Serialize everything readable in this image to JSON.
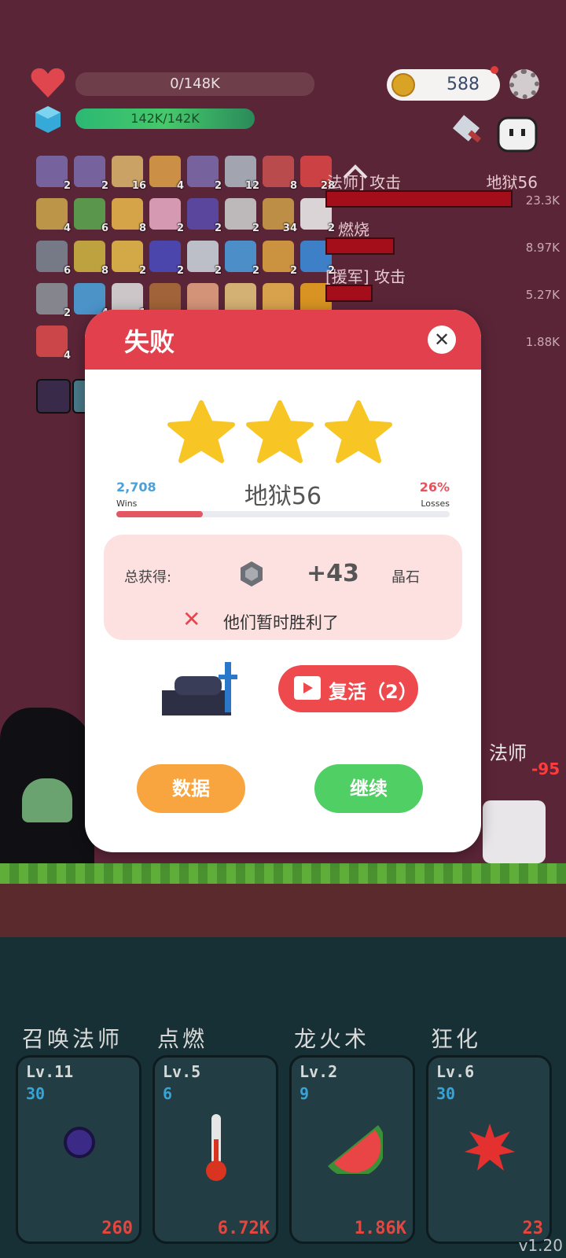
{
  "hud": {
    "hp_text": "0/148K",
    "mp_text": "142K/142K",
    "coins": "588"
  },
  "items": [
    {
      "count": "2"
    },
    {
      "count": "2"
    },
    {
      "count": "16"
    },
    {
      "count": "4"
    },
    {
      "count": "2"
    },
    {
      "count": "12"
    },
    {
      "count": "8"
    },
    {
      "count": "28"
    },
    {
      "count": "4"
    },
    {
      "count": "6"
    },
    {
      "count": "8"
    },
    {
      "count": "2"
    },
    {
      "count": "2"
    },
    {
      "count": "2"
    },
    {
      "count": "34"
    },
    {
      "count": "2"
    },
    {
      "count": "6"
    },
    {
      "count": "8"
    },
    {
      "count": "2"
    },
    {
      "count": "2"
    },
    {
      "count": "2"
    },
    {
      "count": "2"
    },
    {
      "count": "2"
    },
    {
      "count": "2"
    },
    {
      "count": "2"
    },
    {
      "count": "4"
    },
    {
      "count": "1"
    },
    {
      "count": ""
    },
    {
      "count": ""
    },
    {
      "count": ""
    },
    {
      "count": ""
    },
    {
      "count": ""
    },
    {
      "count": "4"
    }
  ],
  "log": [
    {
      "label": "法师] 攻击",
      "value": "23.3K"
    },
    {
      "label": "燃烧",
      "value": "8.97K"
    },
    {
      "label": "[援军] 攻击",
      "value": "5.27K"
    },
    {
      "label": "",
      "value": "1.88K"
    }
  ],
  "log_header": "地狱56",
  "dialog": {
    "title": "失败",
    "close": "✕",
    "wins_value": "2,708",
    "wins_label": "Wins",
    "losses_value": "26%",
    "losses_label": "Losses",
    "level_name": "地狱56",
    "progress": 0.26,
    "reward_label": "总获得:",
    "reward_value": "+43",
    "reward_unit": "晶石",
    "result_message": "他们暂时胜利了",
    "revive_label": "复活（2）",
    "data_button": "数据",
    "continue_button": "继续"
  },
  "skills": [
    {
      "name": "召唤法师",
      "level": "Lv.11",
      "sub": "30",
      "cost": "260"
    },
    {
      "name": "点燃",
      "level": "Lv.5",
      "sub": "6",
      "cost": "6.72K"
    },
    {
      "name": "龙火术",
      "level": "Lv.2",
      "sub": "9",
      "cost": "1.86K"
    },
    {
      "name": "狂化",
      "level": "Lv.6",
      "sub": "30",
      "cost": "23"
    }
  ],
  "enemy_label": "法师",
  "damage_text": "-95",
  "version": "v1.20",
  "colors": {
    "background": "#5b2538",
    "dialog_header": "#e2404c",
    "wins": "#4aa0d8",
    "losses": "#e5535d",
    "data_button": "#f8a53f",
    "continue_button": "#4fcf64",
    "revive_button": "#ee4a4e"
  }
}
